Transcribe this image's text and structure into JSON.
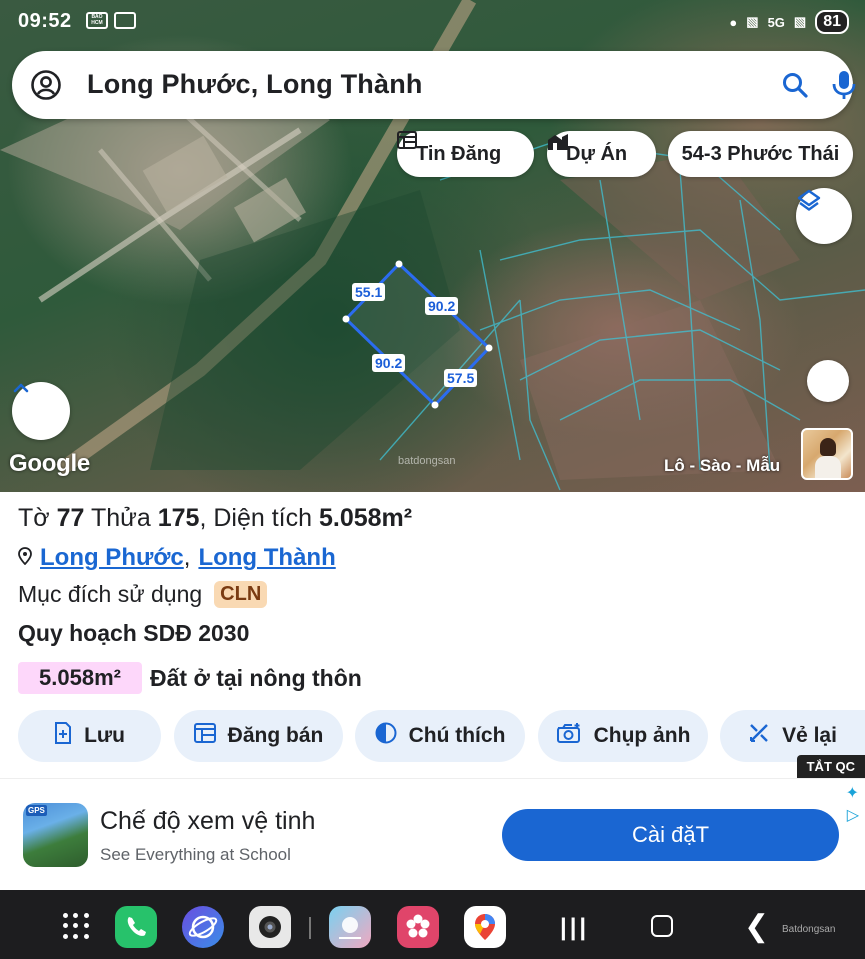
{
  "status": {
    "time": "09:52",
    "icon_badge1": "BÁO HCM",
    "network": "5G",
    "battery": "81"
  },
  "search": {
    "query": "Long Phước, Long Thành"
  },
  "chips": {
    "tin_dang": "Tin Đăng",
    "du_an": "Dự Án",
    "address": "54-3 Phước Thái"
  },
  "map": {
    "google_logo": "Google",
    "watermark": "batdongsan",
    "layer_label": "Lô - Sào - Mẫu",
    "edges": {
      "top": "55.1",
      "right_top": "90.2",
      "left_bottom": "90.2",
      "right_bottom": "57.5"
    }
  },
  "parcel": {
    "to_label": "Tờ",
    "to_value": "77",
    "thua_label": "Thửa",
    "thua_value": "175",
    "area_label": "Diện tích",
    "area_value": "5.058m²",
    "ward_link": "Long Phước",
    "district_link": "Long Thành",
    "purpose_label": "Mục đích sử dụng",
    "purpose_code": "CLN",
    "plan_title": "Quy hoạch SDĐ 2030",
    "plan_area": "5.058m²",
    "plan_zone": "Đất ở tại nông thôn"
  },
  "actions": {
    "save": "Lưu",
    "sell": "Đăng bán",
    "legend": "Chú thích",
    "photo": "Chụp ảnh",
    "redraw": "Vẻ lại"
  },
  "ad": {
    "close_label": "TẮT QC",
    "icon_label": "GPS",
    "title": "Chế độ xem vệ tinh",
    "subtitle": "See Everything at School",
    "cta": "Cài đặT"
  },
  "navbar": {
    "watermark": "Batdongsan"
  },
  "colors": {
    "accent_blue": "#1a66d2",
    "parcel_outline": "#2b6cf0",
    "chip_bg": "#e8f0fa",
    "cln_badge": "#f9d9b3",
    "zone_badge": "#fdd7fa"
  }
}
